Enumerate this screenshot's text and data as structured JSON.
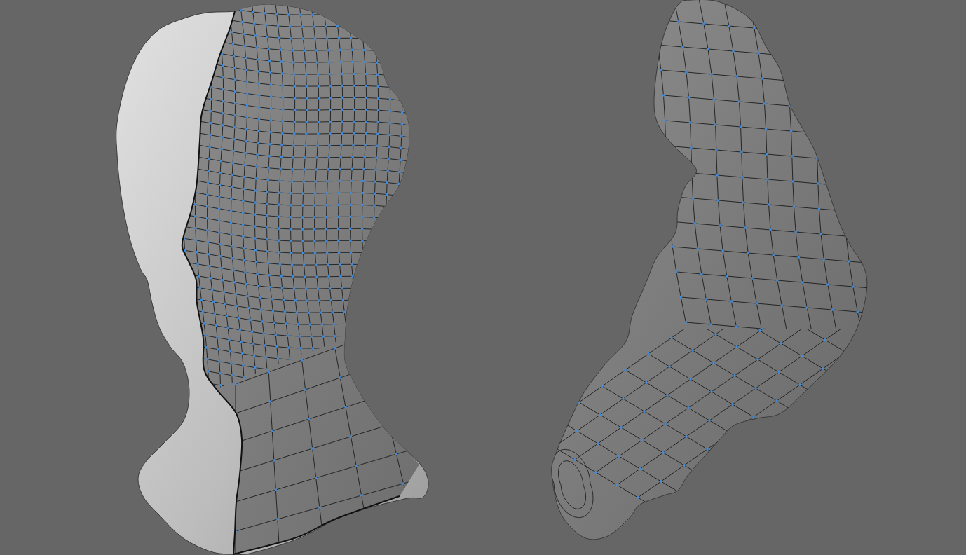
{
  "viewport": {
    "models": [
      {
        "kind": "head"
      },
      {
        "kind": "limb"
      }
    ]
  }
}
